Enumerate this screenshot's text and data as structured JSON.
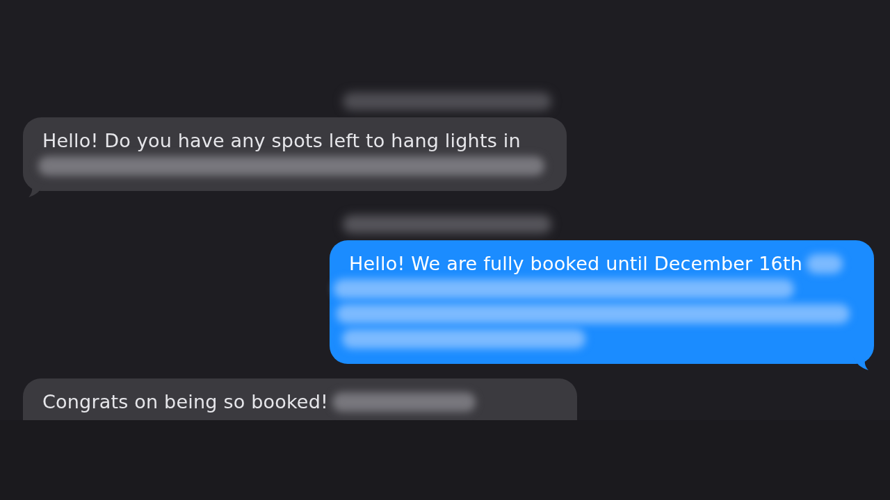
{
  "messages": [
    {
      "kind": "incoming",
      "blurred_timestamp": true,
      "text": "Hello! Do you have any spots left to hang lights in",
      "rest_blurred": true,
      "cut_off": false
    },
    {
      "kind": "outgoing",
      "blurred_timestamp": true,
      "text": "Hello! We are fully booked until December 16th",
      "rest_blurred": true,
      "cut_off": false
    },
    {
      "kind": "incoming",
      "blurred_timestamp": false,
      "text": "Congrats on being so booked!",
      "rest_blurred": true,
      "cut_off": true
    }
  ]
}
